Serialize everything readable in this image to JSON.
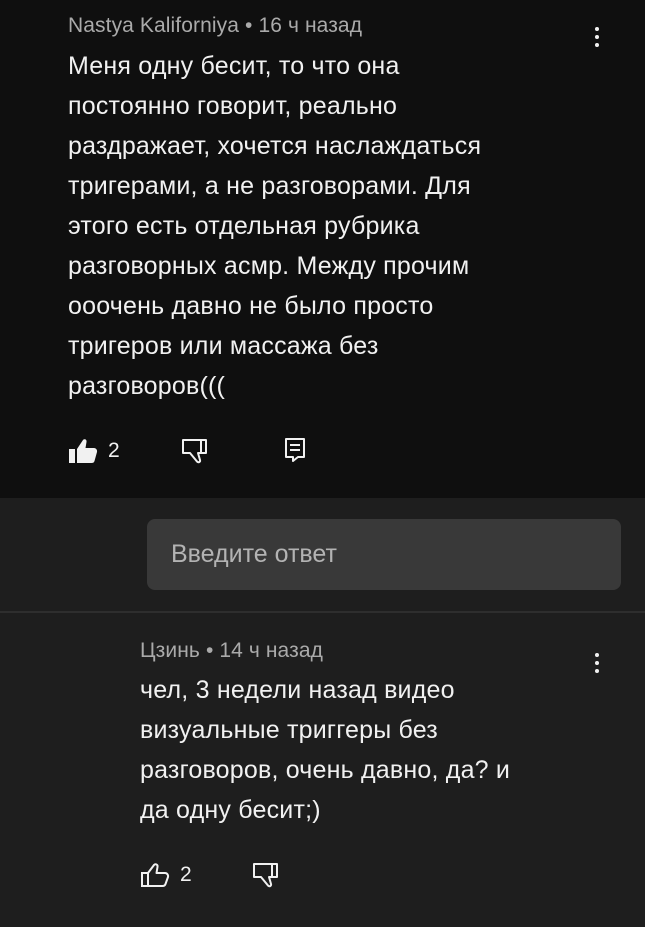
{
  "comment": {
    "author": "Nastya Kalifornіya",
    "separator": "•",
    "time": "16 ч назад",
    "lines": [
      "Меня одну бесит, то что она",
      "постоянно говорит, реально",
      "раздражает, хочется наслаждаться",
      "тригерами, а не разговорами. Для",
      "этого есть отдельная рубрика",
      "разговорных асмр. Между прочим",
      "ооочень давно не было просто",
      "тригеров или массажа без",
      "разговоров((("
    ],
    "likes": "2"
  },
  "reply_box": {
    "placeholder": "Введите ответ"
  },
  "reply": {
    "author": "Цзинь",
    "separator": "•",
    "time": "14 ч назад",
    "lines": [
      "чел, 3 недели назад видео",
      "визуальные триггеры без",
      "разговоров, очень давно, да? и",
      "да одну бесит;)"
    ],
    "likes": "2"
  },
  "icons": {
    "like_filled": "thumbs-up-filled-icon",
    "like_outline": "thumbs-up-outline-icon",
    "dislike": "thumbs-down-outline-icon",
    "reply": "comment-reply-icon",
    "more": "more-vertical-icon"
  }
}
